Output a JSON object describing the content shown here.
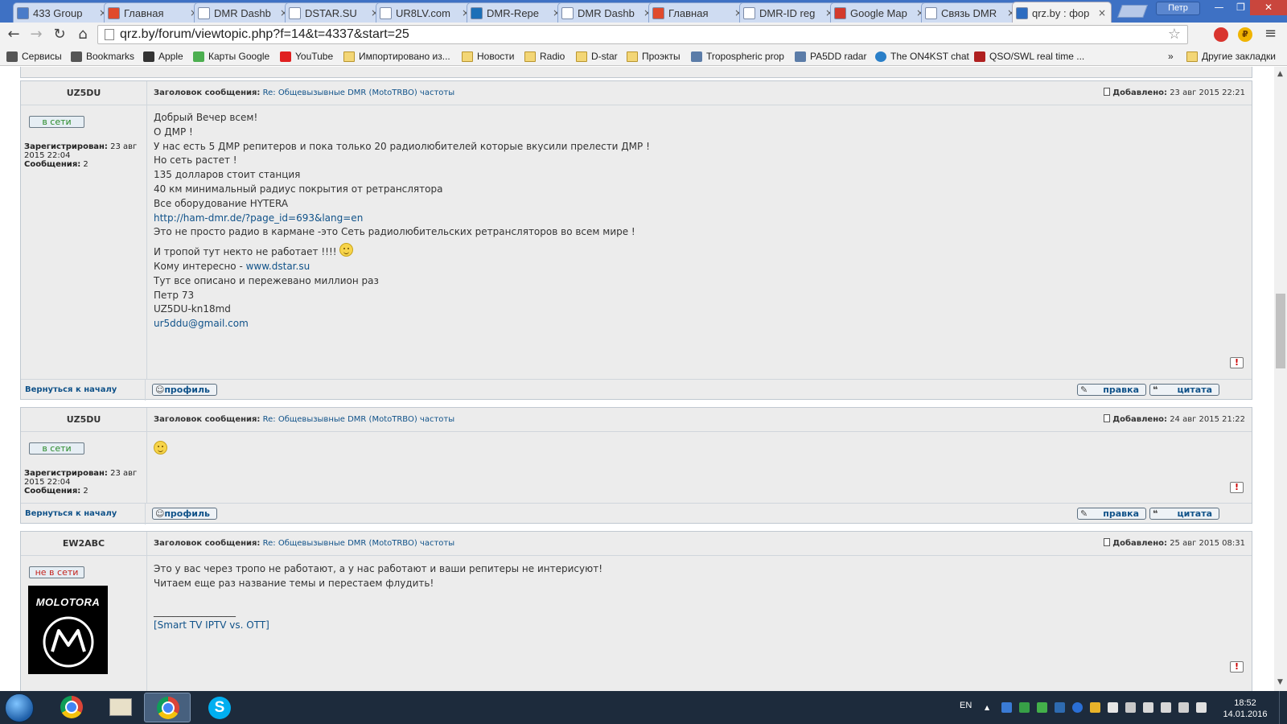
{
  "tabs": [
    {
      "title": "433 Group",
      "icon_color": "#4a7cc9",
      "active": false
    },
    {
      "title": "Главная",
      "icon_color": "#e04a2c",
      "active": false
    },
    {
      "title": "DMR Dashb",
      "icon_color": "#ffffff",
      "active": false
    },
    {
      "title": "DSTAR.SU",
      "icon_color": "#ffffff",
      "active": false
    },
    {
      "title": "UR8LV.com",
      "icon_color": "#ffffff",
      "active": false
    },
    {
      "title": "DMR-Repe",
      "icon_color": "#1c6fb7",
      "active": false
    },
    {
      "title": "DMR Dashb",
      "icon_color": "#ffffff",
      "active": false
    },
    {
      "title": "Главная",
      "icon_color": "#e04a2c",
      "active": false
    },
    {
      "title": "DMR-ID reg",
      "icon_color": "#ffffff",
      "active": false
    },
    {
      "title": "Google Map",
      "icon_color": "#d33a2c",
      "active": false
    },
    {
      "title": "Связь DMR",
      "icon_color": "#ffffff",
      "active": false
    },
    {
      "title": "qrz.by : фор",
      "icon_color": "#2d6cc0",
      "active": true
    }
  ],
  "window": {
    "profile": "Петр",
    "minimize": "—",
    "maximize": "❐",
    "close": "✕"
  },
  "toolbar": {
    "back": "←",
    "forward": "→",
    "reload": "↻",
    "home": "⌂",
    "url": "qrz.by/forum/viewtopic.php?f=14&t=4337&start=25",
    "star": "☆",
    "menu": "≡",
    "ext_rub": "₽"
  },
  "bookmarks": [
    {
      "label": "Сервисы",
      "type": "apps"
    },
    {
      "label": "Bookmarks",
      "type": "star"
    },
    {
      "label": "Apple",
      "type": "apple"
    },
    {
      "label": "Карты Google",
      "type": "maps"
    },
    {
      "label": "YouTube",
      "type": "youtube"
    },
    {
      "label": "Импортировано из...",
      "type": "folder"
    },
    {
      "label": "Новости",
      "type": "folder"
    },
    {
      "label": "Radio",
      "type": "folder"
    },
    {
      "label": "D-star",
      "type": "folder"
    },
    {
      "label": "Проэкты",
      "type": "folder"
    },
    {
      "label": "Tropospheric prop",
      "type": "site"
    },
    {
      "label": "PA5DD radar",
      "type": "site"
    },
    {
      "label": "The ON4KST chat",
      "type": "globe"
    },
    {
      "label": "QSO/SWL real time ...",
      "type": "qso"
    }
  ],
  "bookmarks_more": "»",
  "bookmarks_other": "Другие закладки",
  "forum": {
    "subject_label": "Заголовок сообщения:",
    "posted_label": "Добавлено:",
    "registered_label": "Зарегистрирован:",
    "posts_label": "Сообщения:",
    "back_to_top": "Вернуться к началу",
    "btn_profile": "профиль",
    "btn_edit": "правка",
    "btn_quote": "цитата",
    "report_mark": "!"
  },
  "posts": [
    {
      "author": "UZ5DU",
      "subject": "Re: Общевызывные DMR (MotoTRBO) частоты",
      "date": "23 авг 2015 22:21",
      "status": "в сети",
      "status_color": "#2a8b2a",
      "registered": "23 авг 2015 22:04",
      "post_count": "2",
      "lines": [
        "Добрый Вечер всем!",
        "О ДМР !",
        "У нас есть 5 ДМР репитеров и пока только 20 радиолюбителей которые вкусили прелести ДМР !",
        "Но сеть растет !",
        "135 долларов стоит станция",
        "40 км минимальный радиус покрытия от ретранслятора",
        "Все оборудование HYTERA",
        "http://ham-dmr.de/?page_id=693&lang=en",
        "Это не просто радио в кармане -это Сеть радиолюбительских ретрансляторов во всем мире !",
        "И тропой тут некто не работает !!!!",
        "Кому интересно - ",
        "www.dstar.su",
        "Тут все описано и пережевано миллион раз",
        "Петр 73",
        "UZ5DU-kn18md",
        "ur5ddu@gmail.com"
      ]
    },
    {
      "author": "UZ5DU",
      "subject": "Re: Общевызывные DMR (MotoTRBO) частоты",
      "date": "24 авг 2015 21:22",
      "status": "в сети",
      "status_color": "#2a8b2a",
      "registered": "23 авг 2015 22:04",
      "post_count": "2",
      "lines": []
    },
    {
      "author": "EW2ABC",
      "subject": "Re: Общевызывные DMR (MotoTRBO) частоты",
      "date": "25 авг 2015 08:31",
      "status": "не в сети",
      "status_color": "#c4241e",
      "avatar_text": "MOLOTORA",
      "lines": [
        "Это у вас через тропо не работают, а у нас работают и ваши репитеры не интерисуют!",
        "Читаем еще раз название темы и перестаем флудить!",
        "_________________",
        "[Smart TV IPTV vs. OTT]"
      ]
    }
  ],
  "taskbar": {
    "lang": "EN",
    "time": "18:52",
    "date": "14.01.2016",
    "skype_letter": "S",
    "tray_arrow": "▲"
  }
}
